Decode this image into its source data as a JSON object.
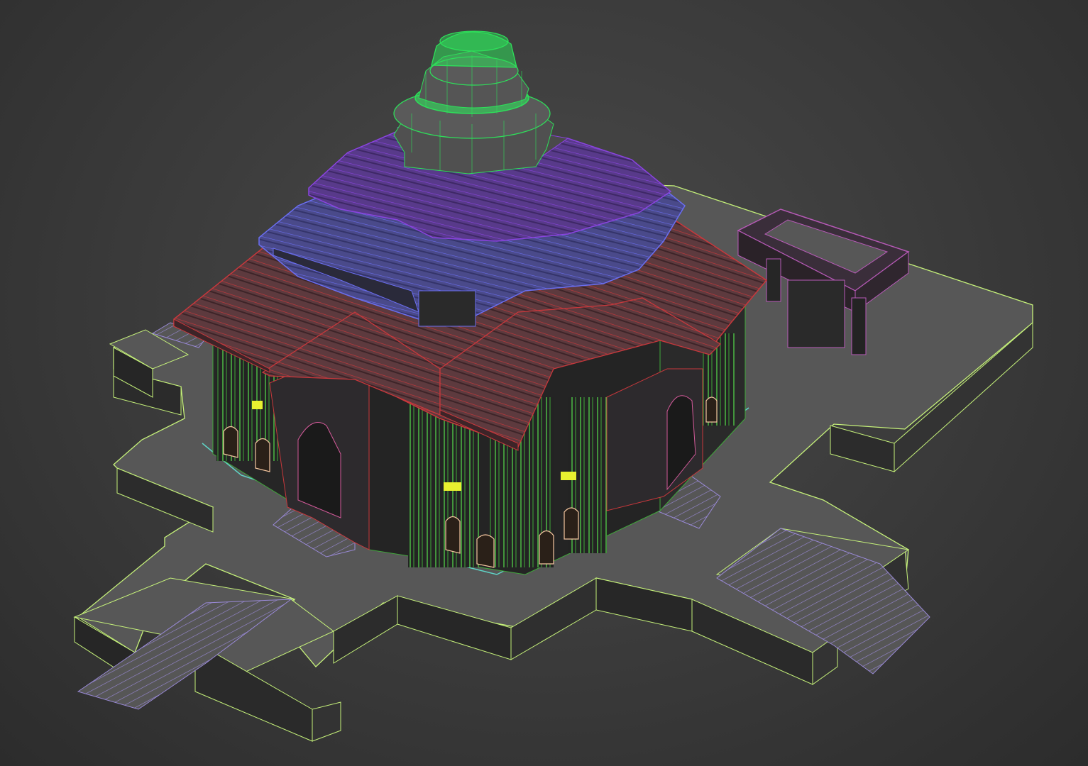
{
  "viewport": {
    "background": "#3b3b3b",
    "shading_mode": "smooth-with-wireframe-edges"
  },
  "scene": {
    "objects": [
      {
        "name": "terrace-platform",
        "wire_color": "#c6f27a"
      },
      {
        "name": "stair-flight",
        "wire_color": "#9a8ad8",
        "count": 6
      },
      {
        "name": "main-hall-columns",
        "wire_color": "#52d24a"
      },
      {
        "name": "door-arches",
        "wire_color": "#f5c7a0"
      },
      {
        "name": "plinth-trim",
        "wire_color": "#5fd6c8"
      },
      {
        "name": "lower-roof-tiles",
        "wire_color": "#c8383c"
      },
      {
        "name": "middle-roof-tiles",
        "wire_color": "#5a5ee8"
      },
      {
        "name": "upper-roof-tiles",
        "wire_color": "#8a44e0"
      },
      {
        "name": "green-dome-finial",
        "wire_color": "#2ee05a"
      },
      {
        "name": "side-gate-frame",
        "wire_color": "#b85ab8"
      },
      {
        "name": "window-lights",
        "wire_color": "#e8f030"
      }
    ]
  }
}
